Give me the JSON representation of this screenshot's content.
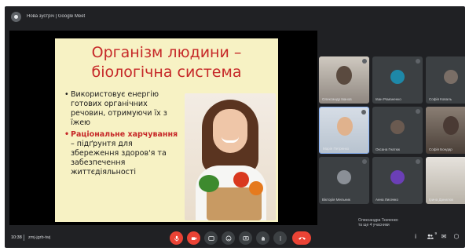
{
  "meeting": {
    "title": "Нова зустріч | Google Meet",
    "time": "10:38",
    "code": "zmj-jgrb-twj"
  },
  "slide": {
    "title_line1": "Організм людини –",
    "title_line2": "біологічна система",
    "bullets": [
      {
        "text": "Використовує енергію готових органічних речовин, отримуючи їх з їжею"
      },
      {
        "highlight": "Раціональне харчування",
        "rest": " – підґрунтя для збереження здоров'я та забезпечення життєдіяльності"
      }
    ]
  },
  "participants": [
    {
      "name": "Олександр Іванов",
      "color": "#5a4a3f"
    },
    {
      "name": "Іван Романенко",
      "color": "#1e88a8"
    },
    {
      "name": "Софія Коваль",
      "color": "#7a6e66"
    },
    {
      "name": "Марія Петренко",
      "color": "#e0b28d"
    },
    {
      "name": "Оксана Гнатюк",
      "color": "#6a5a50"
    },
    {
      "name": "Софія Бондар",
      "color": "#4a3a34"
    },
    {
      "name": "Вікторія Мельник",
      "color": "#8a8f96"
    },
    {
      "name": "Анна Лисенко",
      "color": "#6b3fb6"
    },
    {
      "name": "Ірина Данилюк",
      "color": "#b8b2a8"
    }
  ],
  "others": {
    "line1": "Олександра Ткаченко",
    "line2": "та ще 4 учасники"
  },
  "controls": {
    "mic": "mic-off-icon",
    "camera": "camera-off-icon",
    "captions": "cc-icon",
    "emoji": "emoji-icon",
    "present": "present-icon",
    "raise_hand": "hand-icon",
    "more": "more-icon",
    "end": "end-call-icon"
  },
  "side": {
    "info": "i",
    "people_count": "9",
    "chat": "✉",
    "activities": "⬡"
  },
  "colors": {
    "background": "#202124",
    "danger": "#ea4335",
    "slide_bg": "#f7f2c4",
    "slide_accent": "#c62828"
  }
}
